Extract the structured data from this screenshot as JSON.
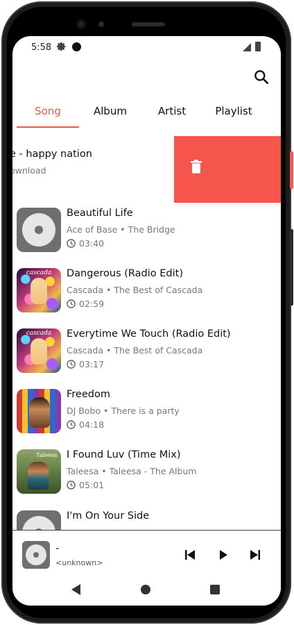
{
  "status_bar": {
    "time": "5:58"
  },
  "tabs": [
    {
      "label": "Song",
      "active": true
    },
    {
      "label": "Album",
      "active": false
    },
    {
      "label": "Artist",
      "active": false
    },
    {
      "label": "Playlist",
      "active": false
    }
  ],
  "swiped_item": {
    "title": "e - happy nation",
    "subtitle": "ownload",
    "action": "delete"
  },
  "songs": [
    {
      "title": "Beautiful Life",
      "subtitle": "Ace of Base • The Bridge",
      "duration": "03:40",
      "art": "disc-placeholder"
    },
    {
      "title": "Dangerous (Radio Edit)",
      "subtitle": "Cascada • The Best of Cascada",
      "duration": "02:59",
      "art": "cascada-cover"
    },
    {
      "title": "Everytime We Touch (Radio Edit)",
      "subtitle": "Cascada • The Best of Cascada",
      "duration": "03:17",
      "art": "cascada-cover"
    },
    {
      "title": "Freedom",
      "subtitle": "DJ Bobo • There is a party",
      "duration": "04:18",
      "art": "djbobo-cover"
    },
    {
      "title": "I Found Luv (Time Mix)",
      "subtitle": "Taleesa • Taleesa - The Album",
      "duration": "05:01",
      "art": "taleesa-cover"
    },
    {
      "title": "I'm On Your Side",
      "subtitle": "",
      "duration": "",
      "art": "disc-placeholder"
    }
  ],
  "album_art_text": {
    "cascada": "cascada",
    "taleesa": "Taleesa"
  },
  "player": {
    "title": "-",
    "subtitle": "<unknown>"
  },
  "colors": {
    "accent": "#f05548",
    "delete": "#f5554a",
    "text": "#111111",
    "subtext": "#777777"
  },
  "icons": [
    "search-icon",
    "trash-icon",
    "clock-icon",
    "previous-icon",
    "play-icon",
    "next-icon",
    "back-icon",
    "home-icon",
    "recents-icon"
  ]
}
